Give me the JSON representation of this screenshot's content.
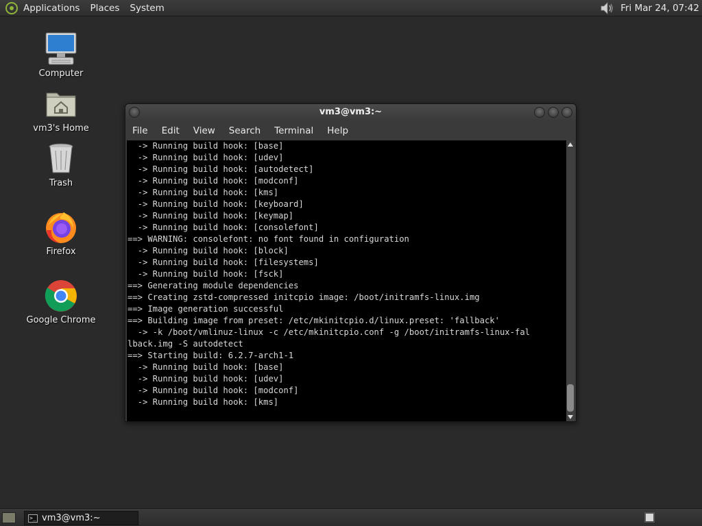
{
  "top_panel": {
    "menus": [
      "Applications",
      "Places",
      "System"
    ],
    "clock": "Fri Mar 24, 07:42"
  },
  "desktop": {
    "icons": [
      {
        "label": "Computer",
        "icon": "computer-icon"
      },
      {
        "label": "vm3's Home",
        "icon": "home-folder-icon"
      },
      {
        "label": "Trash",
        "icon": "trash-icon"
      },
      {
        "label": "Firefox",
        "icon": "firefox-icon"
      },
      {
        "label": "Google Chrome",
        "icon": "chrome-icon"
      }
    ]
  },
  "terminal_window": {
    "title": "vm3@vm3:~",
    "menu": [
      "File",
      "Edit",
      "View",
      "Search",
      "Terminal",
      "Help"
    ],
    "lines": [
      "  -> Running build hook: [base]",
      "  -> Running build hook: [udev]",
      "  -> Running build hook: [autodetect]",
      "  -> Running build hook: [modconf]",
      "  -> Running build hook: [kms]",
      "  -> Running build hook: [keyboard]",
      "  -> Running build hook: [keymap]",
      "  -> Running build hook: [consolefont]",
      "==> WARNING: consolefont: no font found in configuration",
      "  -> Running build hook: [block]",
      "  -> Running build hook: [filesystems]",
      "  -> Running build hook: [fsck]",
      "==> Generating module dependencies",
      "==> Creating zstd-compressed initcpio image: /boot/initramfs-linux.img",
      "==> Image generation successful",
      "==> Building image from preset: /etc/mkinitcpio.d/linux.preset: 'fallback'",
      "  -> -k /boot/vmlinuz-linux -c /etc/mkinitcpio.conf -g /boot/initramfs-linux-fal",
      "lback.img -S autodetect",
      "==> Starting build: 6.2.7-arch1-1",
      "  -> Running build hook: [base]",
      "  -> Running build hook: [udev]",
      "  -> Running build hook: [modconf]",
      "  -> Running build hook: [kms]"
    ]
  },
  "bottom_panel": {
    "task_label": "vm3@vm3:~"
  },
  "colors": {
    "desktop_bg": "#2a2a2a",
    "terminal_bg": "#000000",
    "terminal_fg": "#d8d8d8"
  }
}
